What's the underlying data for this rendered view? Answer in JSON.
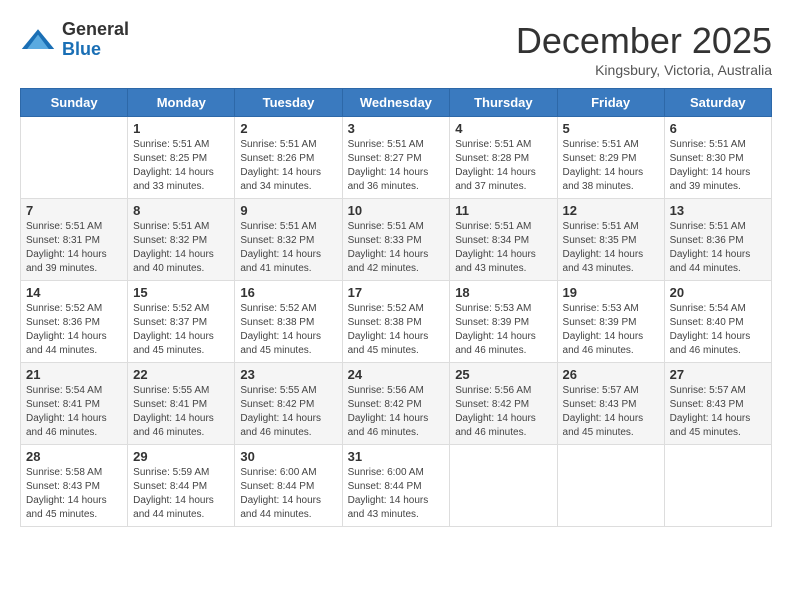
{
  "header": {
    "logo_general": "General",
    "logo_blue": "Blue",
    "month_title": "December 2025",
    "location": "Kingsbury, Victoria, Australia"
  },
  "weekdays": [
    "Sunday",
    "Monday",
    "Tuesday",
    "Wednesday",
    "Thursday",
    "Friday",
    "Saturday"
  ],
  "weeks": [
    [
      {
        "day": "",
        "info": ""
      },
      {
        "day": "1",
        "info": "Sunrise: 5:51 AM\nSunset: 8:25 PM\nDaylight: 14 hours\nand 33 minutes."
      },
      {
        "day": "2",
        "info": "Sunrise: 5:51 AM\nSunset: 8:26 PM\nDaylight: 14 hours\nand 34 minutes."
      },
      {
        "day": "3",
        "info": "Sunrise: 5:51 AM\nSunset: 8:27 PM\nDaylight: 14 hours\nand 36 minutes."
      },
      {
        "day": "4",
        "info": "Sunrise: 5:51 AM\nSunset: 8:28 PM\nDaylight: 14 hours\nand 37 minutes."
      },
      {
        "day": "5",
        "info": "Sunrise: 5:51 AM\nSunset: 8:29 PM\nDaylight: 14 hours\nand 38 minutes."
      },
      {
        "day": "6",
        "info": "Sunrise: 5:51 AM\nSunset: 8:30 PM\nDaylight: 14 hours\nand 39 minutes."
      }
    ],
    [
      {
        "day": "7",
        "info": "Sunrise: 5:51 AM\nSunset: 8:31 PM\nDaylight: 14 hours\nand 39 minutes."
      },
      {
        "day": "8",
        "info": "Sunrise: 5:51 AM\nSunset: 8:32 PM\nDaylight: 14 hours\nand 40 minutes."
      },
      {
        "day": "9",
        "info": "Sunrise: 5:51 AM\nSunset: 8:32 PM\nDaylight: 14 hours\nand 41 minutes."
      },
      {
        "day": "10",
        "info": "Sunrise: 5:51 AM\nSunset: 8:33 PM\nDaylight: 14 hours\nand 42 minutes."
      },
      {
        "day": "11",
        "info": "Sunrise: 5:51 AM\nSunset: 8:34 PM\nDaylight: 14 hours\nand 43 minutes."
      },
      {
        "day": "12",
        "info": "Sunrise: 5:51 AM\nSunset: 8:35 PM\nDaylight: 14 hours\nand 43 minutes."
      },
      {
        "day": "13",
        "info": "Sunrise: 5:51 AM\nSunset: 8:36 PM\nDaylight: 14 hours\nand 44 minutes."
      }
    ],
    [
      {
        "day": "14",
        "info": "Sunrise: 5:52 AM\nSunset: 8:36 PM\nDaylight: 14 hours\nand 44 minutes."
      },
      {
        "day": "15",
        "info": "Sunrise: 5:52 AM\nSunset: 8:37 PM\nDaylight: 14 hours\nand 45 minutes."
      },
      {
        "day": "16",
        "info": "Sunrise: 5:52 AM\nSunset: 8:38 PM\nDaylight: 14 hours\nand 45 minutes."
      },
      {
        "day": "17",
        "info": "Sunrise: 5:52 AM\nSunset: 8:38 PM\nDaylight: 14 hours\nand 45 minutes."
      },
      {
        "day": "18",
        "info": "Sunrise: 5:53 AM\nSunset: 8:39 PM\nDaylight: 14 hours\nand 46 minutes."
      },
      {
        "day": "19",
        "info": "Sunrise: 5:53 AM\nSunset: 8:39 PM\nDaylight: 14 hours\nand 46 minutes."
      },
      {
        "day": "20",
        "info": "Sunrise: 5:54 AM\nSunset: 8:40 PM\nDaylight: 14 hours\nand 46 minutes."
      }
    ],
    [
      {
        "day": "21",
        "info": "Sunrise: 5:54 AM\nSunset: 8:41 PM\nDaylight: 14 hours\nand 46 minutes."
      },
      {
        "day": "22",
        "info": "Sunrise: 5:55 AM\nSunset: 8:41 PM\nDaylight: 14 hours\nand 46 minutes."
      },
      {
        "day": "23",
        "info": "Sunrise: 5:55 AM\nSunset: 8:42 PM\nDaylight: 14 hours\nand 46 minutes."
      },
      {
        "day": "24",
        "info": "Sunrise: 5:56 AM\nSunset: 8:42 PM\nDaylight: 14 hours\nand 46 minutes."
      },
      {
        "day": "25",
        "info": "Sunrise: 5:56 AM\nSunset: 8:42 PM\nDaylight: 14 hours\nand 46 minutes."
      },
      {
        "day": "26",
        "info": "Sunrise: 5:57 AM\nSunset: 8:43 PM\nDaylight: 14 hours\nand 45 minutes."
      },
      {
        "day": "27",
        "info": "Sunrise: 5:57 AM\nSunset: 8:43 PM\nDaylight: 14 hours\nand 45 minutes."
      }
    ],
    [
      {
        "day": "28",
        "info": "Sunrise: 5:58 AM\nSunset: 8:43 PM\nDaylight: 14 hours\nand 45 minutes."
      },
      {
        "day": "29",
        "info": "Sunrise: 5:59 AM\nSunset: 8:44 PM\nDaylight: 14 hours\nand 44 minutes."
      },
      {
        "day": "30",
        "info": "Sunrise: 6:00 AM\nSunset: 8:44 PM\nDaylight: 14 hours\nand 44 minutes."
      },
      {
        "day": "31",
        "info": "Sunrise: 6:00 AM\nSunset: 8:44 PM\nDaylight: 14 hours\nand 43 minutes."
      },
      {
        "day": "",
        "info": ""
      },
      {
        "day": "",
        "info": ""
      },
      {
        "day": "",
        "info": ""
      }
    ]
  ]
}
